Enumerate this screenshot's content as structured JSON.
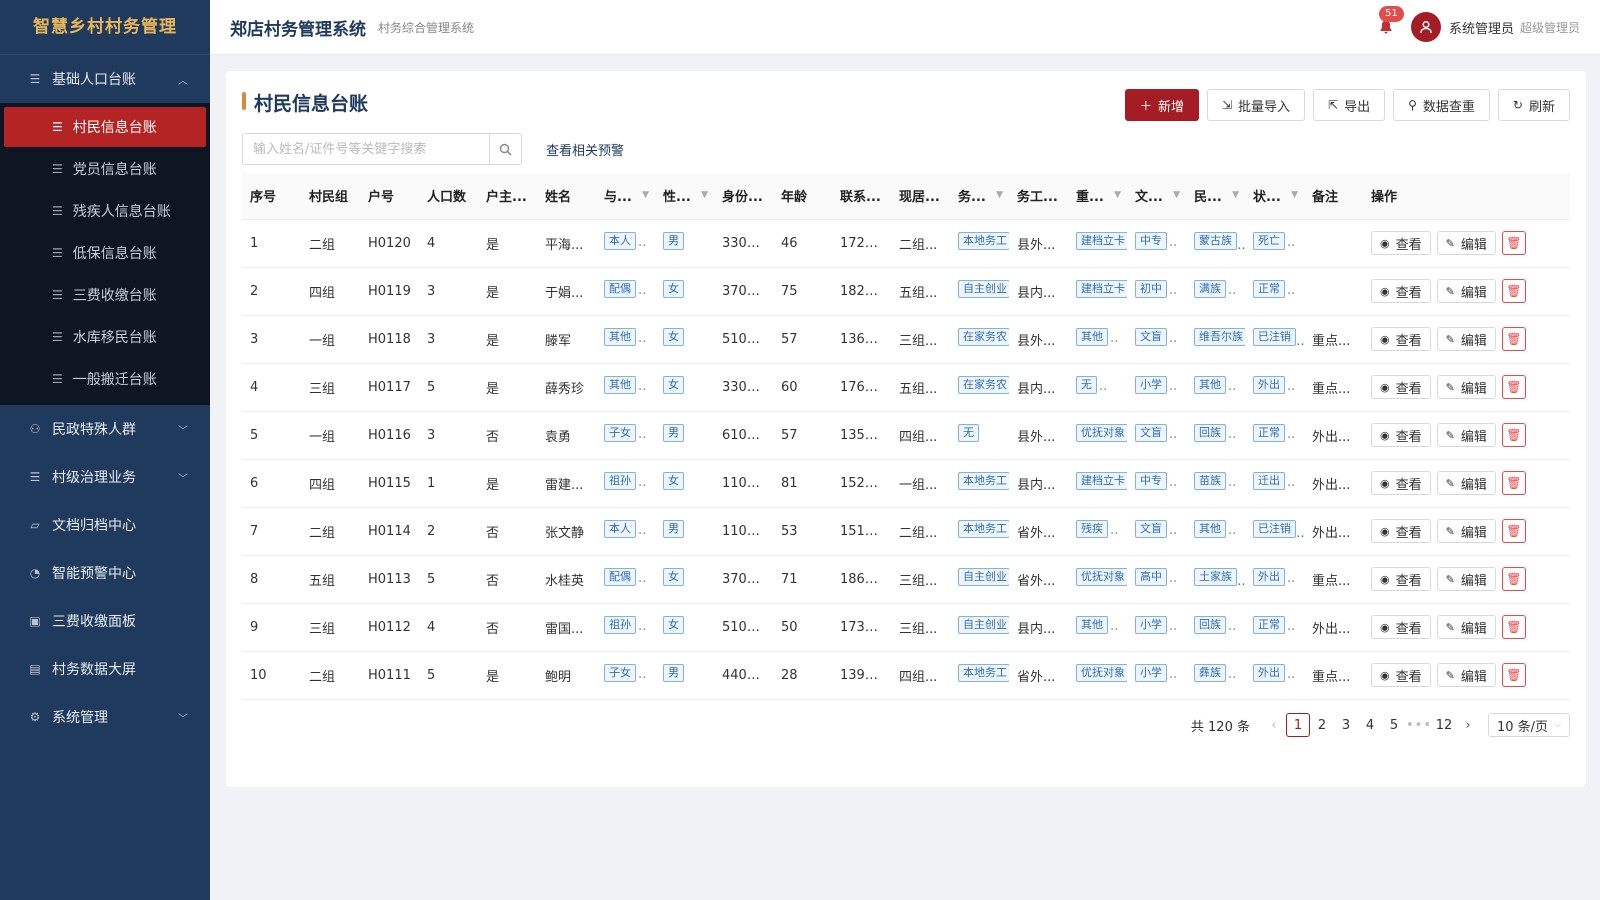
{
  "app": {
    "brand": "智慧乡村村务管理",
    "title": "郑店村务管理系统",
    "subtitle": "村务综合管理系统"
  },
  "header": {
    "notification_count": "51",
    "user_name": "系统管理员",
    "user_role": "超级管理员"
  },
  "sidebar": {
    "groups": [
      {
        "label": "基础人口台账",
        "icon": "list-icon",
        "expanded": true
      },
      {
        "label": "民政特殊人群",
        "icon": "person-icon",
        "expanded": false
      },
      {
        "label": "村级治理业务",
        "icon": "list-icon",
        "expanded": false
      },
      {
        "label": "文档归档中心",
        "icon": "folder-icon",
        "expanded": false
      },
      {
        "label": "智能预警中心",
        "icon": "bell-icon",
        "expanded": false
      },
      {
        "label": "三费收缴面板",
        "icon": "receipt-icon",
        "expanded": false
      },
      {
        "label": "村务数据大屏",
        "icon": "chart-icon",
        "expanded": false
      },
      {
        "label": "系统管理",
        "icon": "gear-icon",
        "expanded": false
      }
    ],
    "sub_items": [
      {
        "label": "村民信息台账",
        "active": true
      },
      {
        "label": "党员信息台账",
        "active": false
      },
      {
        "label": "残疾人信息台账",
        "active": false
      },
      {
        "label": "低保信息台账",
        "active": false
      },
      {
        "label": "三费收缴台账",
        "active": false
      },
      {
        "label": "水库移民台账",
        "active": false
      },
      {
        "label": "一般搬迁台账",
        "active": false
      }
    ]
  },
  "page": {
    "title": "村民信息台账",
    "toolbar": {
      "add": "新增",
      "import": "批量导入",
      "export": "导出",
      "dedupe": "数据查重",
      "refresh": "刷新"
    },
    "search_placeholder": "输入姓名/证件号等关键字搜索",
    "warn_link": "查看相关预警"
  },
  "table": {
    "headers": [
      "序号",
      "村民组",
      "户号",
      "人口数",
      "户主...",
      "姓名",
      "与...",
      "性...",
      "身份...",
      "年龄",
      "联系...",
      "现居...",
      "务...",
      "务工...",
      "重...",
      "文...",
      "民...",
      "状...",
      "备注",
      "操作"
    ],
    "view_label": "查看",
    "edit_label": "编辑",
    "rows": [
      {
        "no": "1",
        "group": "二组",
        "household": "H0120",
        "pop": "4",
        "head": "是",
        "name": "平海...",
        "relation": "本人",
        "gender": "男",
        "id": "3301...",
        "age": "46",
        "phone": "172*...",
        "address": "二组...",
        "work": "本地务工",
        "workplace": "县外...",
        "key": "建档立卡",
        "edu": "中专",
        "ethnic": "蒙古族",
        "status": "死亡",
        "note": ""
      },
      {
        "no": "2",
        "group": "四组",
        "household": "H0119",
        "pop": "3",
        "head": "是",
        "name": "于娟...",
        "relation": "配偶",
        "gender": "女",
        "id": "3701...",
        "age": "75",
        "phone": "182*...",
        "address": "五组...",
        "work": "自主创业",
        "workplace": "县内...",
        "key": "建档立卡",
        "edu": "初中",
        "ethnic": "满族",
        "status": "正常",
        "note": ""
      },
      {
        "no": "3",
        "group": "一组",
        "household": "H0118",
        "pop": "3",
        "head": "是",
        "name": "滕军",
        "relation": "其他",
        "gender": "女",
        "id": "5101...",
        "age": "57",
        "phone": "136*...",
        "address": "三组...",
        "work": "在家务农",
        "workplace": "县外...",
        "key": "其他",
        "edu": "文盲",
        "ethnic": "维吾尔族",
        "status": "已注销",
        "note": "重点..."
      },
      {
        "no": "4",
        "group": "三组",
        "household": "H0117",
        "pop": "5",
        "head": "是",
        "name": "薛秀珍",
        "relation": "其他",
        "gender": "女",
        "id": "3301...",
        "age": "60",
        "phone": "176*...",
        "address": "五组...",
        "work": "在家务农",
        "workplace": "县内...",
        "key": "无",
        "edu": "小学",
        "ethnic": "其他",
        "status": "外出",
        "note": "重点..."
      },
      {
        "no": "5",
        "group": "一组",
        "household": "H0116",
        "pop": "3",
        "head": "否",
        "name": "袁勇",
        "relation": "子女",
        "gender": "男",
        "id": "6101...",
        "age": "57",
        "phone": "135*...",
        "address": "四组...",
        "work": "无",
        "workplace": "县外...",
        "key": "优抚对象",
        "edu": "文盲",
        "ethnic": "回族",
        "status": "正常",
        "note": "外出..."
      },
      {
        "no": "6",
        "group": "四组",
        "household": "H0115",
        "pop": "1",
        "head": "是",
        "name": "雷建...",
        "relation": "祖孙",
        "gender": "女",
        "id": "1101...",
        "age": "81",
        "phone": "152*...",
        "address": "一组...",
        "work": "本地务工",
        "workplace": "县内...",
        "key": "建档立卡",
        "edu": "中专",
        "ethnic": "苗族",
        "status": "迁出",
        "note": "外出..."
      },
      {
        "no": "7",
        "group": "二组",
        "household": "H0114",
        "pop": "2",
        "head": "否",
        "name": "张文静",
        "relation": "本人",
        "gender": "男",
        "id": "1101...",
        "age": "53",
        "phone": "151*...",
        "address": "二组...",
        "work": "本地务工",
        "workplace": "省外...",
        "key": "残疾",
        "edu": "文盲",
        "ethnic": "其他",
        "status": "已注销",
        "note": "外出..."
      },
      {
        "no": "8",
        "group": "五组",
        "household": "H0113",
        "pop": "5",
        "head": "否",
        "name": "水桂英",
        "relation": "配偶",
        "gender": "女",
        "id": "3701...",
        "age": "71",
        "phone": "186*...",
        "address": "三组...",
        "work": "自主创业",
        "workplace": "省外...",
        "key": "优抚对象",
        "edu": "高中",
        "ethnic": "土家族",
        "status": "外出",
        "note": "重点..."
      },
      {
        "no": "9",
        "group": "三组",
        "household": "H0112",
        "pop": "4",
        "head": "否",
        "name": "雷国...",
        "relation": "祖孙",
        "gender": "女",
        "id": "5101...",
        "age": "50",
        "phone": "173*...",
        "address": "三组...",
        "work": "自主创业",
        "workplace": "县内...",
        "key": "其他",
        "edu": "小学",
        "ethnic": "回族",
        "status": "正常",
        "note": "外出..."
      },
      {
        "no": "10",
        "group": "二组",
        "household": "H0111",
        "pop": "5",
        "head": "是",
        "name": "鲍明",
        "relation": "子女",
        "gender": "男",
        "id": "4401...",
        "age": "28",
        "phone": "139*...",
        "address": "四组...",
        "work": "本地务工",
        "workplace": "省外...",
        "key": "优抚对象",
        "edu": "小学",
        "ethnic": "彝族",
        "status": "外出",
        "note": "重点..."
      }
    ]
  },
  "pagination": {
    "total": "共 120 条",
    "pages": [
      "1",
      "2",
      "3",
      "4",
      "5"
    ],
    "dots": "•••",
    "last": "12",
    "current": "1",
    "page_size": "10 条/页"
  },
  "colors": {
    "sidebar": "#1f3a5c",
    "accent": "#a51d24",
    "brand": "#e8b55a",
    "tag_text": "#2d6fb3"
  }
}
